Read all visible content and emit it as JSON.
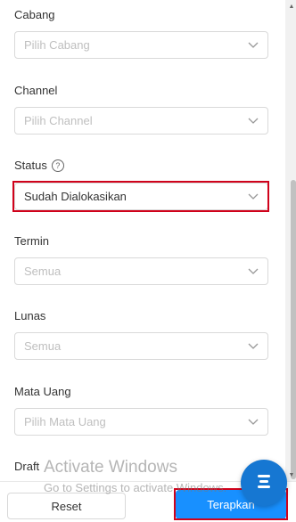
{
  "filters": {
    "cabang": {
      "label": "Cabang",
      "placeholder": "Pilih Cabang"
    },
    "channel": {
      "label": "Channel",
      "placeholder": "Pilih Channel"
    },
    "status": {
      "label": "Status",
      "help": "?",
      "value": "Sudah Dialokasikan"
    },
    "termin": {
      "label": "Termin",
      "placeholder": "Semua"
    },
    "lunas": {
      "label": "Lunas",
      "placeholder": "Semua"
    },
    "mata_uang": {
      "label": "Mata Uang",
      "placeholder": "Pilih Mata Uang"
    },
    "draft": {
      "label": "Draft"
    }
  },
  "footer": {
    "reset_label": "Reset",
    "apply_label": "Terapkan"
  },
  "watermark": {
    "line1": "Activate Windows",
    "line2": "Go to Settings to activate Windows."
  },
  "colors": {
    "primary": "#1890ff",
    "highlight": "#d0021b",
    "fab": "#1677d2"
  },
  "icons": {
    "select_arrow": "chevron-down-icon",
    "fab": "menu-icon",
    "help": "question-circle-icon"
  }
}
